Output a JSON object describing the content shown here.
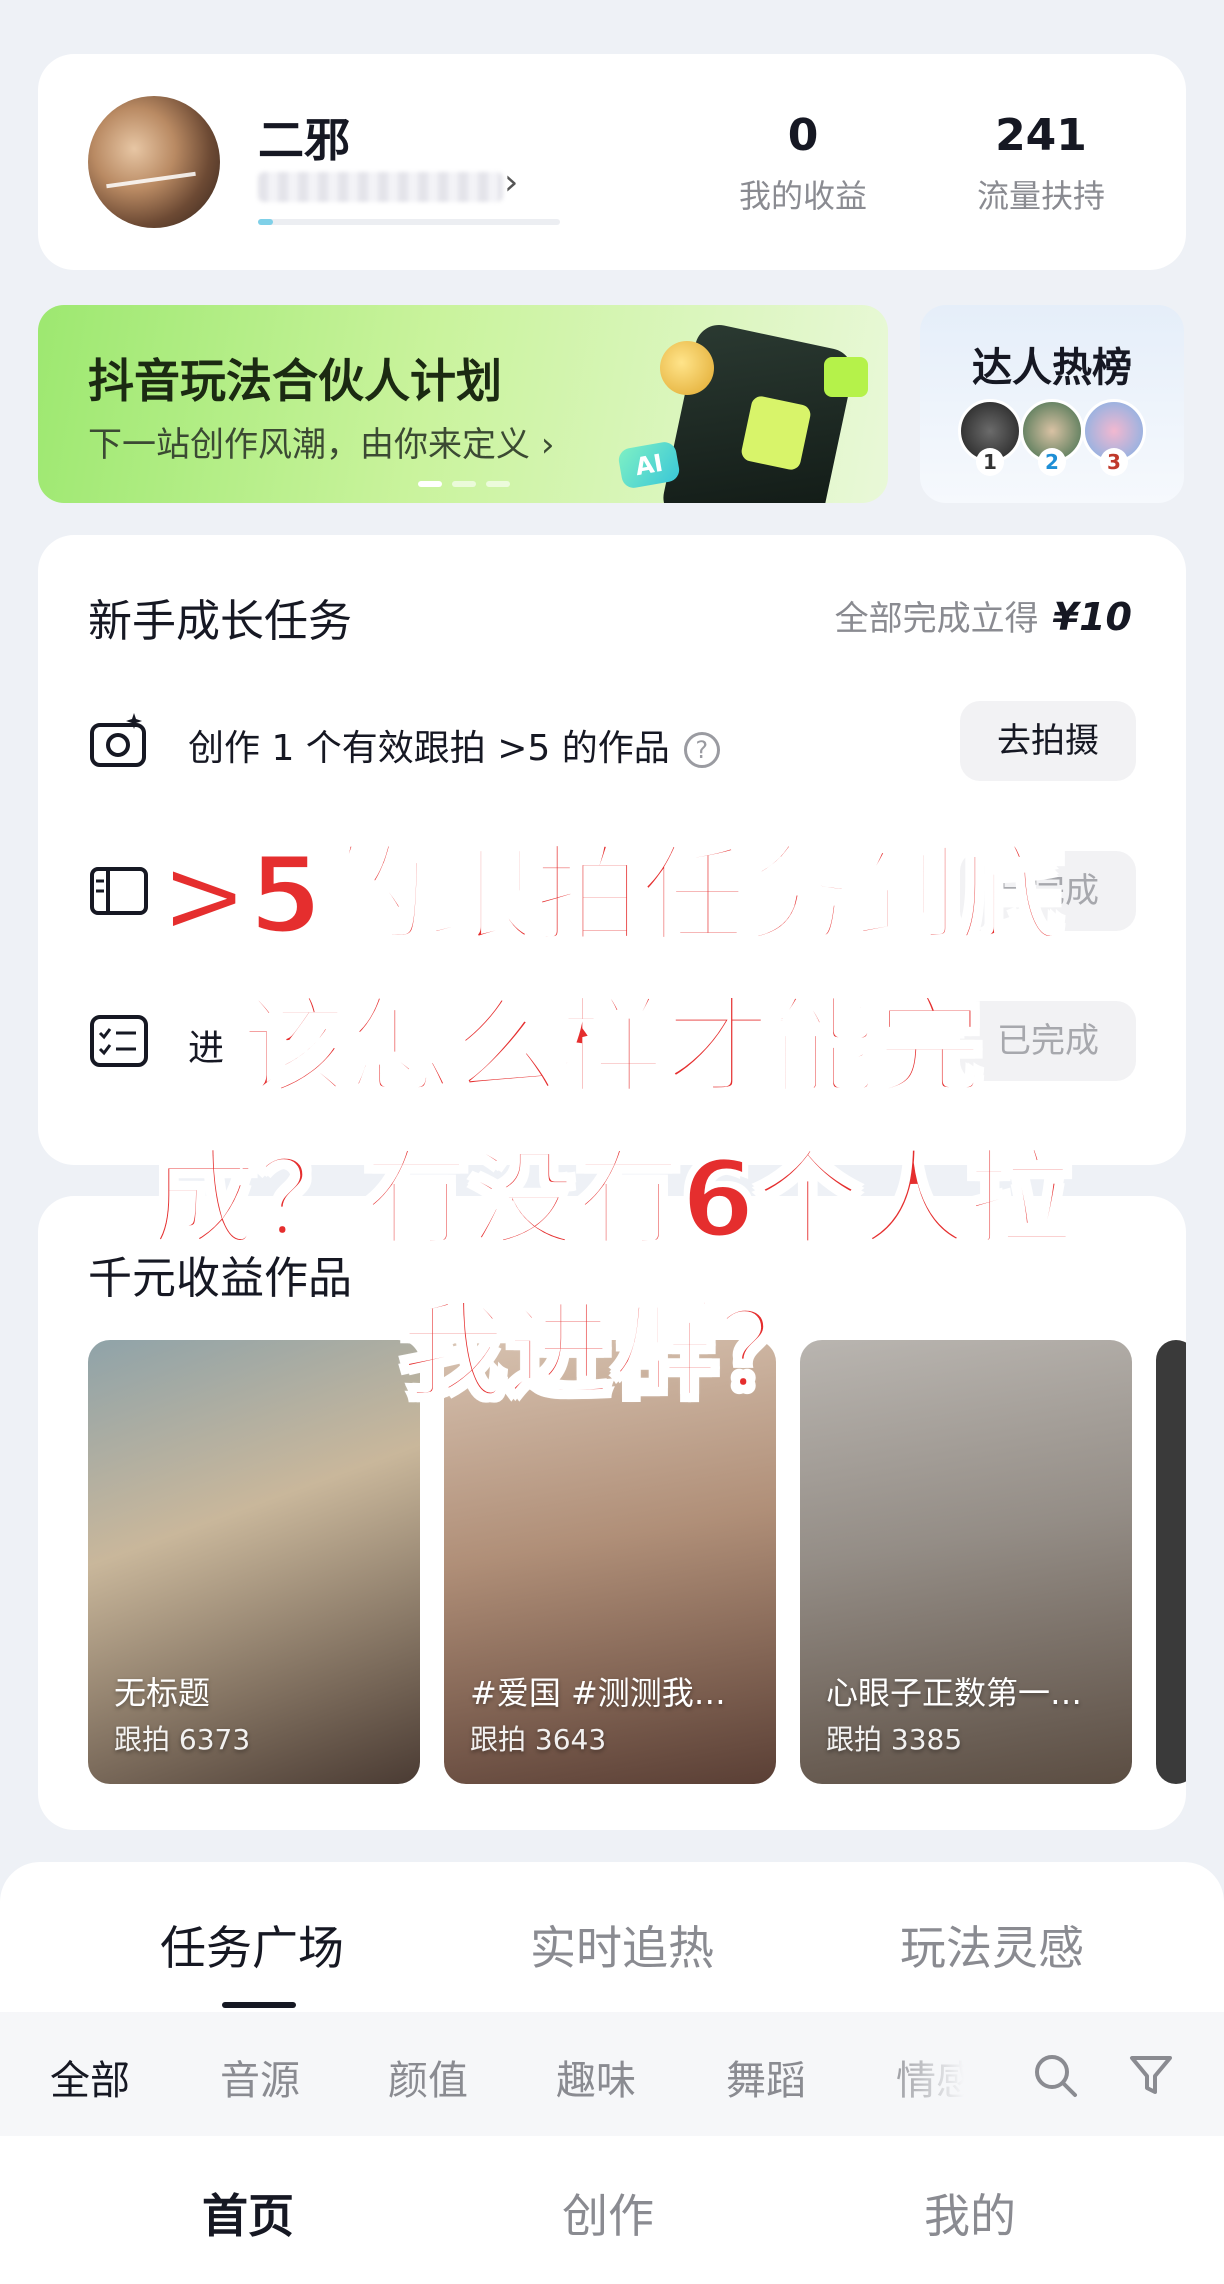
{
  "profile": {
    "username": "二邪",
    "progress_percent": 5,
    "stats": [
      {
        "value": "0",
        "label": "我的收益"
      },
      {
        "value": "241",
        "label": "流量扶持"
      }
    ]
  },
  "banner": {
    "title": "抖音玩法合伙人计划",
    "subtitle": "下一站创作风潮，由你来定义",
    "ai_badge": "AI",
    "active_slide": 1,
    "slide_count": 3
  },
  "hot_list": {
    "title": "达人热榜",
    "ranks": [
      "1",
      "2",
      "3"
    ]
  },
  "tasks": {
    "title": "新手成长任务",
    "reward_label": "全部完成立得",
    "reward_amount": "¥10",
    "items": [
      {
        "icon": "camera-sparkle-icon",
        "text": "创作 1 个有效跟拍 >5 的作品",
        "button": "去拍摄"
      },
      {
        "icon": "book-icon",
        "text": "",
        "button": "已完成"
      },
      {
        "icon": "checklist-icon",
        "text": "进",
        "button": "已完成"
      }
    ]
  },
  "works": {
    "title": "千元收益作品",
    "items": [
      {
        "title": "无标题",
        "count": "跟拍 6373"
      },
      {
        "title": "#爱国 #测测我…",
        "count": "跟拍 3643"
      },
      {
        "title": "心眼子正数第一…",
        "count": "跟拍 3385"
      }
    ]
  },
  "tabs": [
    "任务广场",
    "实时追热",
    "玩法灵感"
  ],
  "filters": [
    "全部",
    "音源",
    "颜值",
    "趣味",
    "舞蹈",
    "情感"
  ],
  "nav": [
    "首页",
    "创作",
    "我的"
  ],
  "overlay": {
    "lines": [
      ">5的跟拍任务到底",
      "该怎么样才能完",
      "成？有没有6个人拉",
      "我进群？"
    ]
  },
  "colors": {
    "accent_red": "#e52e2e",
    "banner_green": "#9de870",
    "text_primary": "#161823",
    "text_secondary": "#8a8b91"
  }
}
